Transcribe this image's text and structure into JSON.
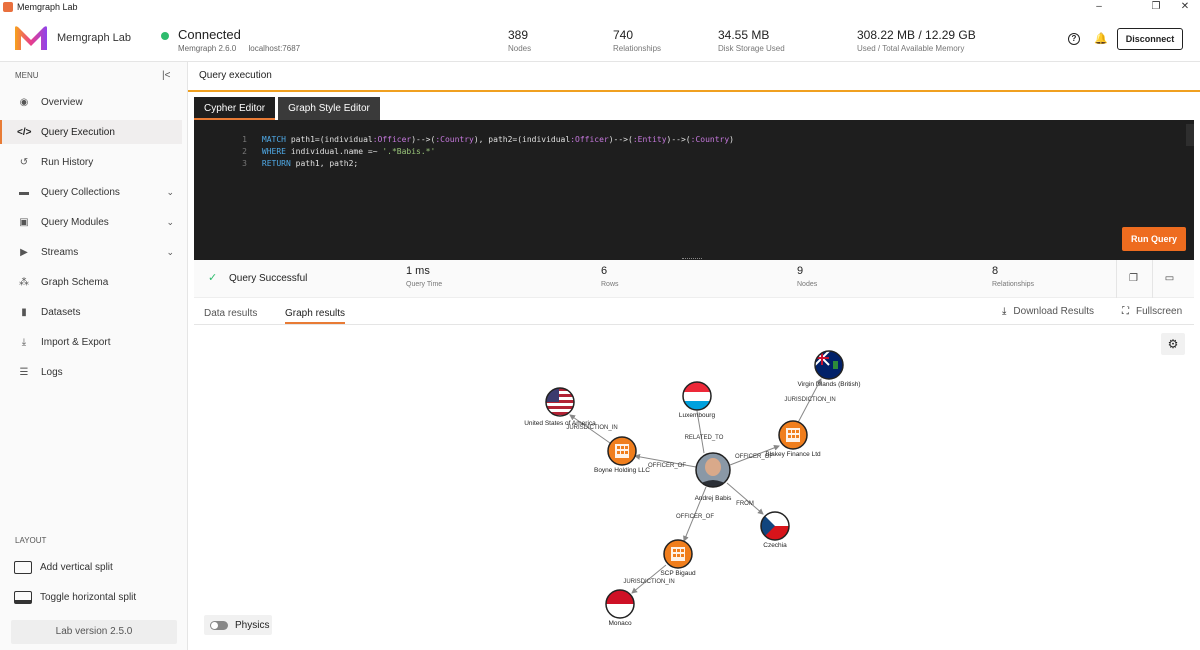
{
  "window": {
    "title": "Memgraph Lab",
    "minimize": "–",
    "restore": "❐",
    "close": "✕"
  },
  "header": {
    "brand": "Memgraph Lab",
    "connection": {
      "status": "Connected",
      "version": "Memgraph 2.6.0",
      "host": "localhost:7687"
    },
    "stats": [
      {
        "value": "389",
        "label": "Nodes"
      },
      {
        "value": "740",
        "label": "Relationships"
      },
      {
        "value": "34.55 MB",
        "label": "Disk Storage Used"
      },
      {
        "value": "308.22 MB / 12.29 GB",
        "label": "Used / Total Available Memory"
      }
    ],
    "disconnect_label": "Disconnect"
  },
  "sidebar": {
    "menu_label": "MENU",
    "items": [
      {
        "label": "Overview",
        "icon": "eye-icon"
      },
      {
        "label": "Query Execution",
        "icon": "code-icon",
        "active": true
      },
      {
        "label": "Run History",
        "icon": "history-icon"
      },
      {
        "label": "Query Collections",
        "icon": "folder-icon"
      },
      {
        "label": "Query Modules",
        "icon": "module-icon"
      },
      {
        "label": "Streams",
        "icon": "play-icon"
      },
      {
        "label": "Graph Schema",
        "icon": "schema-icon"
      },
      {
        "label": "Datasets",
        "icon": "book-icon"
      },
      {
        "label": "Import & Export",
        "icon": "download-icon"
      },
      {
        "label": "Logs",
        "icon": "list-icon"
      }
    ],
    "layout_label": "LAYOUT",
    "add_vertical_split": "Add vertical split",
    "toggle_horizontal_split": "Toggle horizontal split",
    "version": "Lab version 2.5.0"
  },
  "main": {
    "title": "Query execution",
    "tabs": [
      "Cypher Editor",
      "Graph Style Editor"
    ],
    "editor": {
      "line_numbers": [
        "1",
        "2",
        "3"
      ],
      "l1": {
        "kw": "MATCH",
        "a": " path1=(individual",
        "b": ":Officer",
        "c": ")-->(",
        "d": ":Country",
        "e": "), path2=(individual",
        "f": ":Officer",
        "g": ")-->(",
        "h": ":Entity",
        "i": ")-->(",
        "j": ":Country",
        "k": ")"
      },
      "l2": {
        "kw": "WHERE",
        "a": " individual.name =~ ",
        "s": "'.*Babis.*'"
      },
      "l3": {
        "kw": "RETURN",
        "a": " path1, path2;"
      }
    },
    "run_label": "Run Query",
    "summary": {
      "status": "Query Successful",
      "stats": [
        {
          "value": "1 ms",
          "label": "Query Time"
        },
        {
          "value": "6",
          "label": "Rows"
        },
        {
          "value": "9",
          "label": "Nodes"
        },
        {
          "value": "8",
          "label": "Relationships"
        }
      ]
    },
    "results": {
      "tabs": [
        "Data results",
        "Graph results"
      ],
      "download": "Download Results",
      "fullscreen": "Fullscreen",
      "physics": "Physics"
    },
    "graph": {
      "nodes": [
        {
          "id": "vig",
          "label": "Virgin Islands (British)"
        },
        {
          "id": "lux",
          "label": "Luxembourg"
        },
        {
          "id": "usa",
          "label": "United States of America"
        },
        {
          "id": "boyne",
          "label": "Boyne Holding LLC"
        },
        {
          "id": "blakey",
          "label": "Blakey Finance Ltd"
        },
        {
          "id": "andrej",
          "label": "Andrej Babis"
        },
        {
          "id": "cz",
          "label": "Czechia"
        },
        {
          "id": "scp",
          "label": "SCP Bigaud"
        },
        {
          "id": "mc",
          "label": "Monaco"
        }
      ],
      "edges": [
        {
          "label": "JURISDICTION_IN"
        },
        {
          "label": "JURISDICTION_IN"
        },
        {
          "label": "RELATED_TO"
        },
        {
          "label": "OFFICER_OF"
        },
        {
          "label": "OFFICER_OF"
        },
        {
          "label": "FROM"
        },
        {
          "label": "OFFICER_OF"
        },
        {
          "label": "JURISDICTION_IN"
        }
      ]
    }
  }
}
